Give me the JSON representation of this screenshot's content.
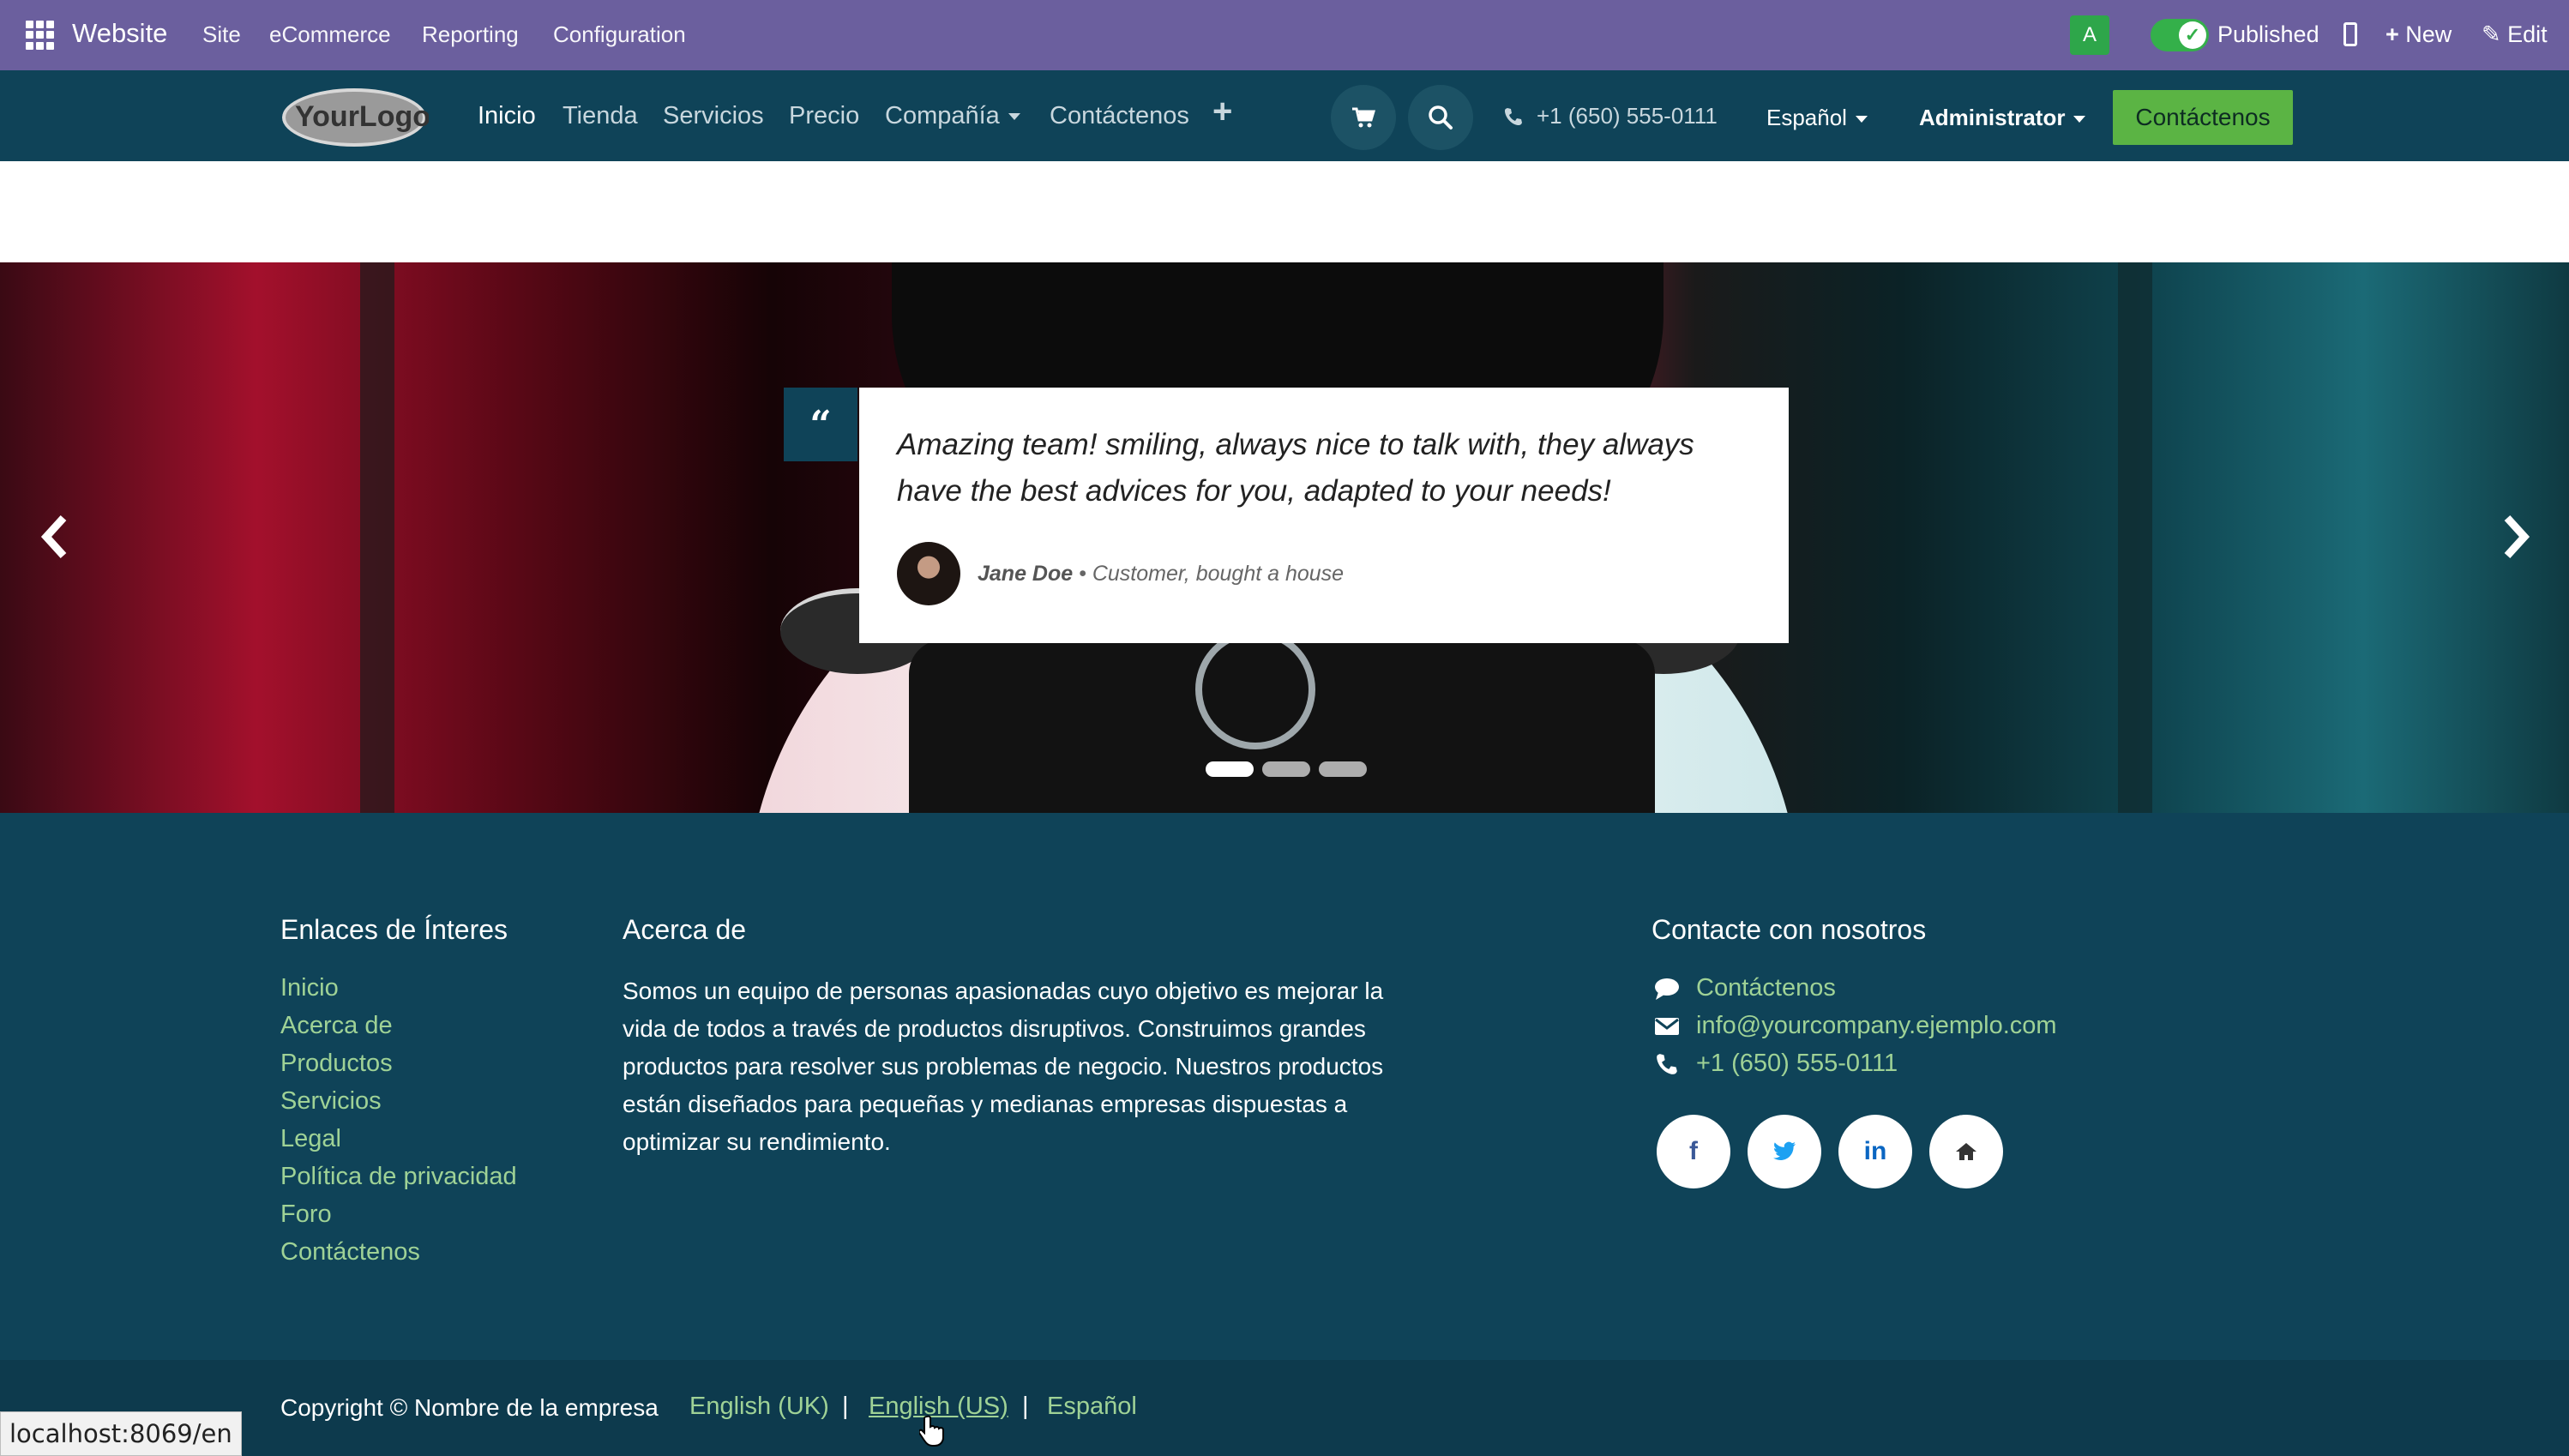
{
  "admin_bar": {
    "app_name": "Website",
    "menu": [
      "Site",
      "eCommerce",
      "Reporting",
      "Configuration"
    ],
    "avatar_letter": "A",
    "published_label": "Published",
    "new_label": "New",
    "edit_label": "Edit",
    "color": "#6b5f9e"
  },
  "header": {
    "logo_text": "YourLogo",
    "nav": [
      "Inicio",
      "Tienda",
      "Servicios",
      "Precio",
      "Compañía",
      "Contáctenos"
    ],
    "active_nav": "Inicio",
    "phone": "+1 (650) 555-0111",
    "language": "Español",
    "user": "Administrator",
    "cta_label": "Contáctenos",
    "color": "#0f4358",
    "cta_color": "#5bb444"
  },
  "testimonial": {
    "quote": "Amazing team! smiling, always nice to talk with, they always have the best advices for you, adapted to your needs!",
    "author": "Jane Doe",
    "role": "Customer, bought a house",
    "slides": 3,
    "active_slide": 1
  },
  "footer": {
    "links_title": "Enlaces de Ínteres",
    "links": [
      "Inicio",
      "Acerca de",
      "Productos",
      "Servicios",
      "Legal",
      "Política de privacidad",
      "Foro",
      "Contáctenos"
    ],
    "about_title": "Acerca de",
    "about_text": "Somos un equipo de personas apasionadas cuyo objetivo es mejorar la vida de todos a través de productos disruptivos. Construimos grandes productos para resolver sus problemas de negocio. Nuestros productos están diseñados para pequeñas y medianas empresas dispuestas a optimizar su rendimiento.",
    "contact_title": "Contacte con nosotros",
    "contact_link": "Contáctenos",
    "email": "info@yourcompany.ejemplo.com",
    "phone": "+1 (650) 555-0111",
    "social": [
      "facebook-icon",
      "twitter-icon",
      "linkedin-icon",
      "home-icon"
    ]
  },
  "copyright": {
    "text": "Copyright © Nombre de la empresa",
    "languages": [
      "English (UK)",
      "English (US)",
      "Español"
    ],
    "hovered_language": "English (US)"
  },
  "status_url": "localhost:8069/en"
}
